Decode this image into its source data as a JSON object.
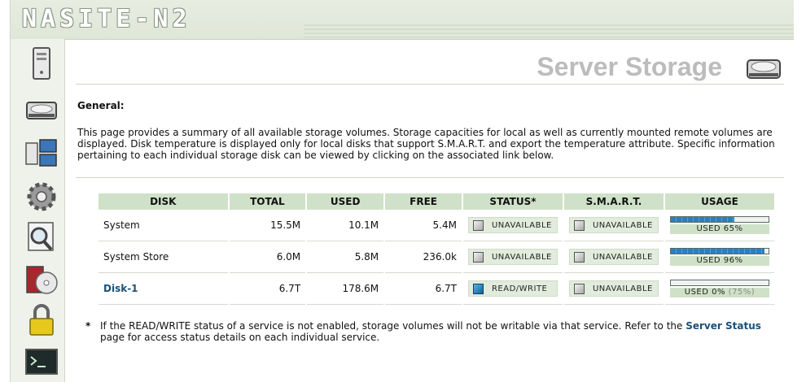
{
  "brand": {
    "logo_text": "NASITE-N2"
  },
  "header": {
    "title": "Server Storage",
    "icon": "hard-drive-icon"
  },
  "sidebar": {
    "items": [
      {
        "name": "server",
        "icon": "server-tower-icon"
      },
      {
        "name": "storage",
        "icon": "hard-drive-icon"
      },
      {
        "name": "network",
        "icon": "network-computers-icon"
      },
      {
        "name": "settings",
        "icon": "gear-icon"
      },
      {
        "name": "search",
        "icon": "magnifier-icon"
      },
      {
        "name": "media",
        "icon": "cd-media-icon"
      },
      {
        "name": "security",
        "icon": "padlock-icon"
      },
      {
        "name": "console",
        "icon": "terminal-icon"
      }
    ]
  },
  "general": {
    "heading": "General:",
    "description": "This page provides a summary of all available storage volumes. Storage capacities for local as well as currently mounted remote volumes are displayed. Disk temperature is displayed only for local disks that support S.M.A.R.T. and export the temperature attribute. Specific information pertaining to each individual storage disk can be viewed by clicking on the associated link below."
  },
  "table": {
    "headers": [
      "DISK",
      "TOTAL",
      "USED",
      "FREE",
      "STATUS*",
      "S.M.A.R.T.",
      "USAGE"
    ],
    "rows": [
      {
        "disk": "System",
        "link": false,
        "total": "15.5M",
        "used": "10.1M",
        "free": "5.4M",
        "status": "UNAVAILABLE",
        "status_on": false,
        "smart": "UNAVAILABLE",
        "usage_label": "USED 65%",
        "usage_extra": "",
        "usage_fraction": 0.65
      },
      {
        "disk": "System Store",
        "link": false,
        "total": "6.0M",
        "used": "5.8M",
        "free": "236.0k",
        "status": "UNAVAILABLE",
        "status_on": false,
        "smart": "UNAVAILABLE",
        "usage_label": "USED 96%",
        "usage_extra": "",
        "usage_fraction": 0.96
      },
      {
        "disk": "Disk-1",
        "link": true,
        "total": "6.7T",
        "used": "178.6M",
        "free": "6.7T",
        "status": "READ/WRITE",
        "status_on": true,
        "smart": "UNAVAILABLE",
        "usage_label": "USED 0%",
        "usage_extra": "(75%)",
        "usage_fraction": 0.0
      }
    ]
  },
  "footnote": {
    "star": "*",
    "text_before": "If the READ/WRITE status of a service is not enabled, storage volumes will not be writable via that service. Refer to the ",
    "link_text": "Server Status",
    "text_after": " page for access status details on each individual service."
  }
}
